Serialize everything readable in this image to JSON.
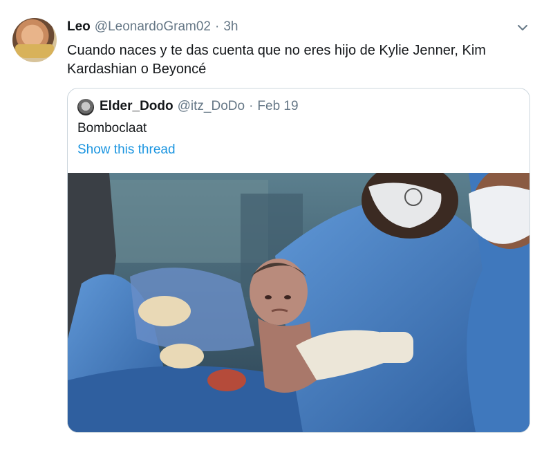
{
  "tweet": {
    "author_name": "Leo",
    "author_handle": "@LeonardoGram02",
    "separator": "·",
    "time": "3h",
    "text": "Cuando naces y te das cuenta que no eres hijo de Kylie Jenner, Kim Kardashian o Beyoncé"
  },
  "quoted_tweet": {
    "author_name": "Elder_Dodo",
    "author_handle": "@itz_DoDo",
    "separator": "·",
    "date": "Feb 19",
    "text": "Bomboclaat",
    "thread_link": "Show this thread"
  },
  "icons": {
    "menu": "chevron-down-icon"
  },
  "colors": {
    "link": "#1b95e0",
    "secondary_text": "#657786",
    "border": "#ccd6dd",
    "scrubs": "#3f73b8"
  }
}
